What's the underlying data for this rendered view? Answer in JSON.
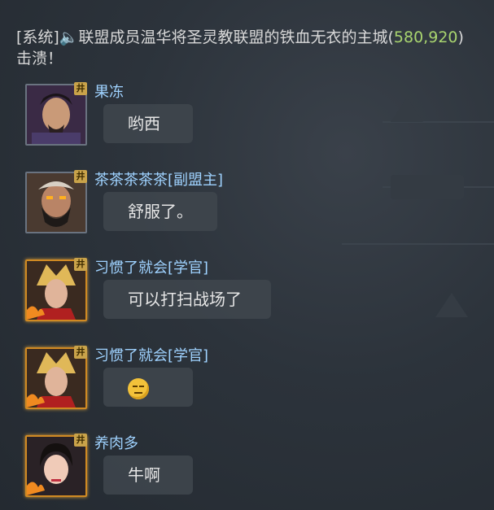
{
  "system_message": {
    "prefix": "[系统]",
    "speaker_glyph": "🔈",
    "text": "联盟成员温华将圣灵教联盟的铁血无衣的主城(",
    "coords": "580,920",
    "suffix": ")击溃！"
  },
  "messages": [
    {
      "sender": "果冻",
      "badge": "井",
      "text": "哟西",
      "avatar_frame": "silver",
      "avatar_icon": "warrior-portrait-icon"
    },
    {
      "sender": "茶茶茶茶茶[副盟主]",
      "badge": "井",
      "text": "舒服了。",
      "avatar_frame": "silver",
      "avatar_icon": "bearded-general-portrait-icon"
    },
    {
      "sender": "习惯了就会[学官]",
      "badge": "井",
      "text": "可以打扫战场了",
      "avatar_frame": "gold",
      "avatar_icon": "golden-helmet-portrait-icon"
    },
    {
      "sender": "习惯了就会[学官]",
      "badge": "井",
      "text": "",
      "emoji": "smirk-emoji-icon",
      "avatar_frame": "gold",
      "avatar_icon": "golden-helmet-portrait-icon"
    },
    {
      "sender": "养肉多",
      "badge": "井",
      "text": "牛啊",
      "avatar_frame": "gold",
      "avatar_icon": "lady-portrait-icon"
    }
  ],
  "colors": {
    "name": "#9fd2ff",
    "coords": "#a8d46f",
    "bubble": "#40464e",
    "gold_frame": "#d08a23"
  }
}
